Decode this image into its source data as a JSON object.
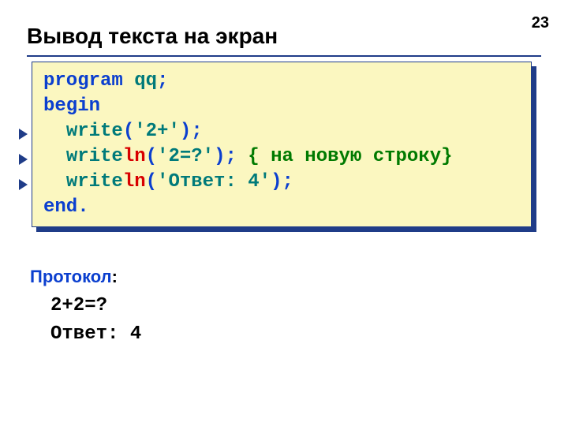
{
  "page_number": "23",
  "title": "Вывод текста на экран",
  "code": {
    "l1_program": "program",
    "l1_name": " qq",
    "l1_semi": ";",
    "l2_begin": "begin",
    "l3_indent": "  ",
    "l3_write": "write",
    "l3_open": "(",
    "l3_arg": "'2+'",
    "l3_close": ")",
    "l3_semi": ";",
    "l4_indent": "  ",
    "l4_write": "write",
    "l4_ln": "ln",
    "l4_open": "(",
    "l4_arg": "'2=?'",
    "l4_close": ")",
    "l4_semi": ";",
    "l4_space": " ",
    "l4_comment": "{ на новую строку}",
    "l5_indent": "  ",
    "l5_write": "write",
    "l5_ln": "ln",
    "l5_open": "(",
    "l5_arg": "'Ответ: 4'",
    "l5_close": ")",
    "l5_semi": ";",
    "l6_end": "end",
    "l6_dot": "."
  },
  "protocol": {
    "label": "Протокол",
    "colon": ":",
    "line1": "2+2=?",
    "line2": "Ответ: 4"
  }
}
